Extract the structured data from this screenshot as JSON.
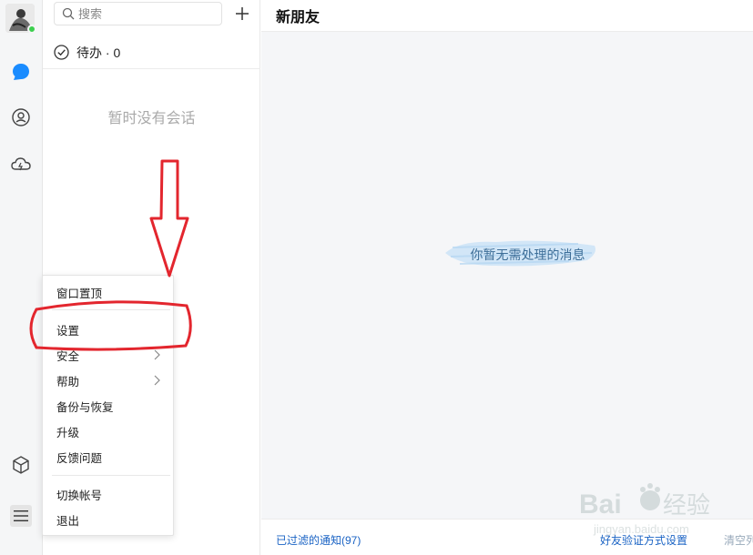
{
  "search": {
    "placeholder": "搜索"
  },
  "todo": {
    "label": "待办 · 0"
  },
  "sessions": {
    "empty_text": "暂时没有会话"
  },
  "main": {
    "title": "新朋友",
    "empty_message": "你暂无需处理的消息",
    "footer": {
      "filtered_label": "已过滤的通知(97)",
      "verify_label": "好友验证方式设置",
      "clear_label": "清空列表"
    }
  },
  "menu": {
    "items": [
      {
        "label": "窗口置顶"
      },
      {
        "label": "设置"
      },
      {
        "label": "安全"
      },
      {
        "label": "帮助"
      },
      {
        "label": "备份与恢复"
      },
      {
        "label": "升级"
      },
      {
        "label": "反馈问题"
      },
      {
        "label": "切换帐号"
      },
      {
        "label": "退出"
      }
    ]
  },
  "rail_icons": [
    "chat-bubble-icon",
    "contacts-icon",
    "cloud-icon",
    "cube-icon",
    "hamburger-menu-icon"
  ],
  "colors": {
    "accent_blue": "#1a8cff",
    "link_blue": "#1a63c4",
    "annotation_red": "#e3262e",
    "online_green": "#3ccf4e"
  }
}
